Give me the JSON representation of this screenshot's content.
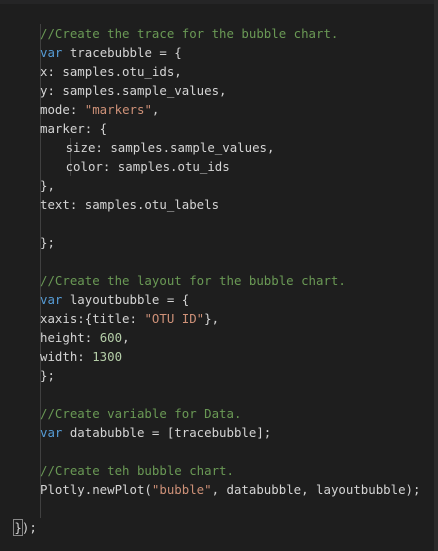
{
  "editor": {
    "lines": [
      {
        "indent": 5,
        "tokens": [
          {
            "t": "//Create the trace for the bubble chart.",
            "c": "comment"
          }
        ]
      },
      {
        "indent": 5,
        "tokens": [
          {
            "t": "var",
            "c": "keyword"
          },
          {
            "t": " tracebubble = {",
            "c": "plain"
          }
        ]
      },
      {
        "indent": 5,
        "tokens": [
          {
            "t": "x: samples.otu_ids,",
            "c": "plain"
          }
        ]
      },
      {
        "indent": 5,
        "tokens": [
          {
            "t": "y: samples.sample_values,",
            "c": "plain"
          }
        ]
      },
      {
        "indent": 5,
        "tokens": [
          {
            "t": "mode: ",
            "c": "plain"
          },
          {
            "t": "\"markers\"",
            "c": "string"
          },
          {
            "t": ",",
            "c": "plain"
          }
        ]
      },
      {
        "indent": 5,
        "tokens": [
          {
            "t": "marker: {",
            "c": "plain"
          }
        ]
      },
      {
        "indent": 9,
        "guide_inner": true,
        "tokens": [
          {
            "t": "size: samples.sample_values,",
            "c": "plain"
          }
        ]
      },
      {
        "indent": 9,
        "guide_inner": true,
        "tokens": [
          {
            "t": "color: samples.otu_ids",
            "c": "plain"
          }
        ]
      },
      {
        "indent": 5,
        "tokens": [
          {
            "t": "},",
            "c": "plain"
          }
        ]
      },
      {
        "indent": 5,
        "tokens": [
          {
            "t": "text: samples.otu_labels",
            "c": "plain"
          }
        ]
      },
      {
        "indent": 0,
        "tokens": []
      },
      {
        "indent": 5,
        "tokens": [
          {
            "t": "};",
            "c": "plain"
          }
        ]
      },
      {
        "indent": 0,
        "tokens": []
      },
      {
        "indent": 5,
        "tokens": [
          {
            "t": "//Create the layout for the bubble chart.",
            "c": "comment"
          }
        ]
      },
      {
        "indent": 5,
        "tokens": [
          {
            "t": "var",
            "c": "keyword"
          },
          {
            "t": " layoutbubble = {",
            "c": "plain"
          }
        ]
      },
      {
        "indent": 5,
        "tokens": [
          {
            "t": "xaxis:{title: ",
            "c": "plain"
          },
          {
            "t": "\"OTU ID\"",
            "c": "string"
          },
          {
            "t": "},",
            "c": "plain"
          }
        ]
      },
      {
        "indent": 5,
        "tokens": [
          {
            "t": "height: ",
            "c": "plain"
          },
          {
            "t": "600",
            "c": "number"
          },
          {
            "t": ",",
            "c": "plain"
          }
        ]
      },
      {
        "indent": 5,
        "tokens": [
          {
            "t": "width: ",
            "c": "plain"
          },
          {
            "t": "1300",
            "c": "number"
          }
        ]
      },
      {
        "indent": 5,
        "tokens": [
          {
            "t": "};",
            "c": "plain"
          }
        ]
      },
      {
        "indent": 0,
        "tokens": []
      },
      {
        "indent": 5,
        "tokens": [
          {
            "t": "//Create variable for Data.",
            "c": "comment"
          }
        ]
      },
      {
        "indent": 5,
        "tokens": [
          {
            "t": "var",
            "c": "keyword"
          },
          {
            "t": " databubble = [tracebubble];",
            "c": "plain"
          }
        ]
      },
      {
        "indent": 0,
        "tokens": []
      },
      {
        "indent": 5,
        "tokens": [
          {
            "t": "//Create teh bubble chart.",
            "c": "comment"
          }
        ]
      },
      {
        "indent": 5,
        "tokens": [
          {
            "t": "Plotly.newPlot(",
            "c": "plain"
          },
          {
            "t": "\"bubble\"",
            "c": "string"
          },
          {
            "t": ", databubble, layoutbubble);",
            "c": "plain"
          }
        ]
      },
      {
        "indent": 0,
        "tokens": []
      },
      {
        "indent": 1,
        "no_guide": true,
        "tokens": [
          {
            "t": "}",
            "c": "bracket-hl"
          },
          {
            "t": ");",
            "c": "plain"
          }
        ]
      }
    ]
  },
  "colors": {
    "background": "#1e1e1e",
    "comment": "#6a9955",
    "keyword": "#569cd6",
    "string": "#ce9178",
    "number": "#b5cea8",
    "text": "#d4d4d4"
  }
}
